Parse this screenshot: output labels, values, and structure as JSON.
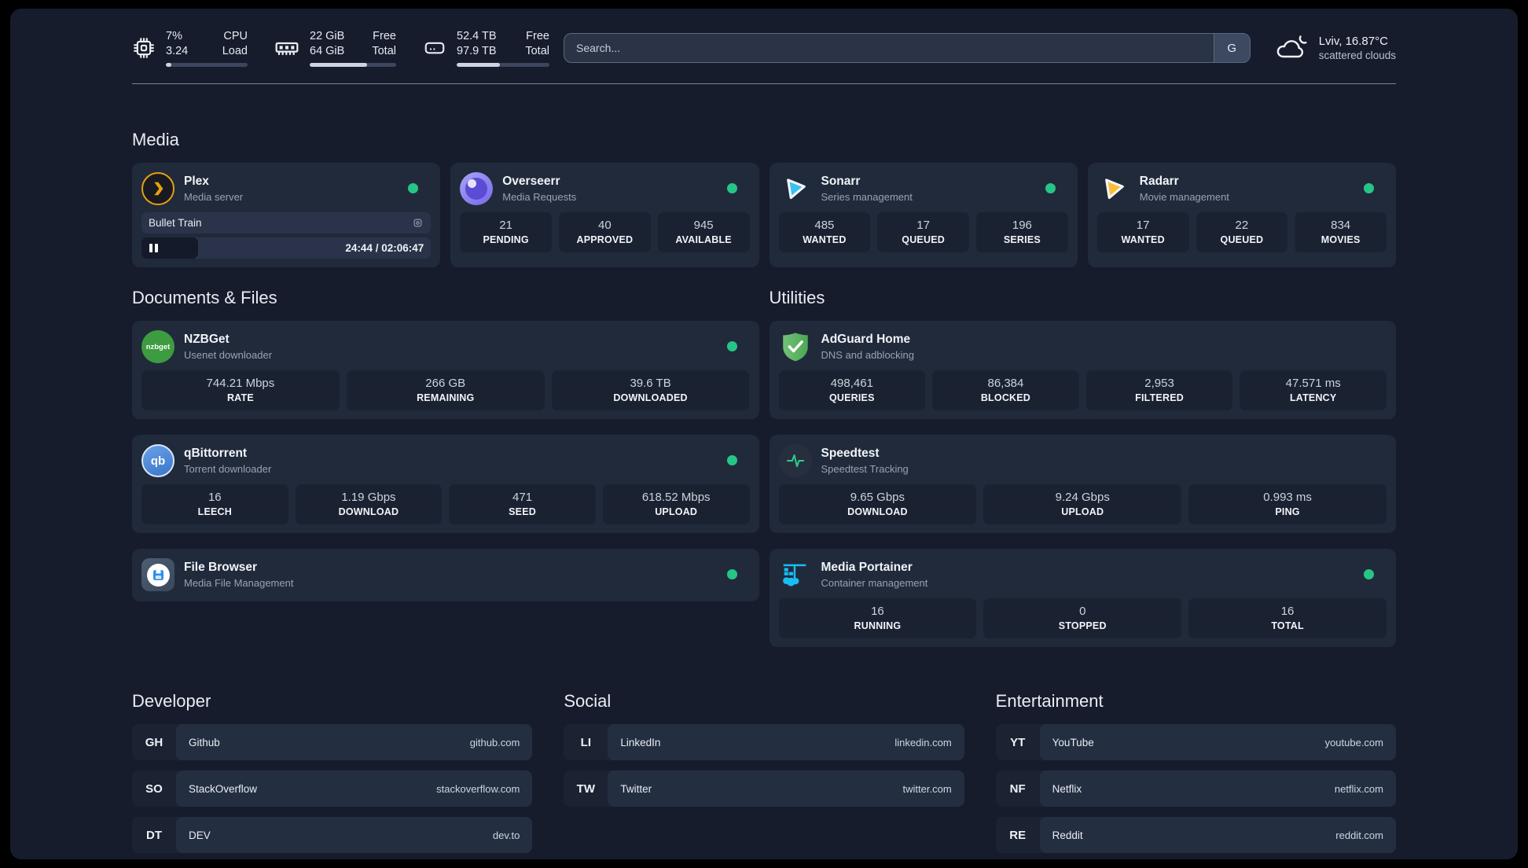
{
  "colors": {
    "page_background": "#161c2c",
    "card_background": "#212a3b",
    "status_online": "#26c585",
    "plex_gold": "#e5a00d",
    "overseerr_purple": "#7668ea",
    "sonarr_blue": "#39c1f0",
    "radarr_gold": "#fcbd35",
    "nzbget_green": "#3d9c40",
    "qbittorrent_blue": "#3a76ca",
    "filebrowser_blue": "#2f8fe8",
    "adguard_green": "#5fb562",
    "speedtest_green": "#2ecc8e",
    "portainer_blue": "#18bdf4"
  },
  "topbar": {
    "cpu": {
      "value1": "7%",
      "value2": "3.24",
      "label1": "CPU",
      "label2": "Load",
      "progress": 7
    },
    "ram": {
      "value1": "22 GiB",
      "value2": "64 GiB",
      "label1": "Free",
      "label2": "Total",
      "progress": 66
    },
    "disk": {
      "value1": "52.4 TB",
      "value2": "97.9 TB",
      "label1": "Free",
      "label2": "Total",
      "progress": 47
    },
    "search": {
      "placeholder": "Search...",
      "button_label": "G"
    },
    "weather": {
      "location": "Lviv, 16.87°C",
      "condition": "scattered clouds"
    }
  },
  "media": {
    "title": "Media",
    "plex": {
      "name": "Plex",
      "description": "Media server",
      "now_playing": "Bullet Train",
      "time": "24:44 / 02:06:47",
      "progress_percent": 19.5
    },
    "overseerr": {
      "name": "Overseerr",
      "description": "Media Requests",
      "stats": [
        {
          "value": "21",
          "label": "PENDING"
        },
        {
          "value": "40",
          "label": "APPROVED"
        },
        {
          "value": "945",
          "label": "AVAILABLE"
        }
      ]
    },
    "sonarr": {
      "name": "Sonarr",
      "description": "Series management",
      "stats": [
        {
          "value": "485",
          "label": "WANTED"
        },
        {
          "value": "17",
          "label": "QUEUED"
        },
        {
          "value": "196",
          "label": "SERIES"
        }
      ]
    },
    "radarr": {
      "name": "Radarr",
      "description": "Movie management",
      "stats": [
        {
          "value": "17",
          "label": "WANTED"
        },
        {
          "value": "22",
          "label": "QUEUED"
        },
        {
          "value": "834",
          "label": "MOVIES"
        }
      ]
    }
  },
  "documents": {
    "title": "Documents & Files",
    "nzbget": {
      "name": "NZBGet",
      "description": "Usenet downloader",
      "icon_text": "nzbget",
      "stats": [
        {
          "value": "744.21 Mbps",
          "label": "RATE"
        },
        {
          "value": "266 GB",
          "label": "REMAINING"
        },
        {
          "value": "39.6 TB",
          "label": "DOWNLOADED"
        }
      ]
    },
    "qbittorrent": {
      "name": "qBittorrent",
      "description": "Torrent downloader",
      "icon_text": "qb",
      "stats": [
        {
          "value": "16",
          "label": "LEECH"
        },
        {
          "value": "1.19 Gbps",
          "label": "DOWNLOAD"
        },
        {
          "value": "471",
          "label": "SEED"
        },
        {
          "value": "618.52 Mbps",
          "label": "UPLOAD"
        }
      ]
    },
    "filebrowser": {
      "name": "File Browser",
      "description": "Media File Management"
    }
  },
  "utilities": {
    "title": "Utilities",
    "adguard": {
      "name": "AdGuard Home",
      "description": "DNS and adblocking",
      "stats": [
        {
          "value": "498,461",
          "label": "QUERIES"
        },
        {
          "value": "86,384",
          "label": "BLOCKED"
        },
        {
          "value": "2,953",
          "label": "FILTERED"
        },
        {
          "value": "47.571 ms",
          "label": "LATENCY"
        }
      ]
    },
    "speedtest": {
      "name": "Speedtest",
      "description": "Speedtest Tracking",
      "stats": [
        {
          "value": "9.65 Gbps",
          "label": "DOWNLOAD"
        },
        {
          "value": "9.24 Gbps",
          "label": "UPLOAD"
        },
        {
          "value": "0.993 ms",
          "label": "PING"
        }
      ]
    },
    "portainer": {
      "name": "Media Portainer",
      "description": "Container management",
      "stats": [
        {
          "value": "16",
          "label": "RUNNING"
        },
        {
          "value": "0",
          "label": "STOPPED"
        },
        {
          "value": "16",
          "label": "TOTAL"
        }
      ]
    }
  },
  "bookmarks": {
    "developer": {
      "title": "Developer",
      "items": [
        {
          "abbr": "GH",
          "name": "Github",
          "url": "github.com"
        },
        {
          "abbr": "SO",
          "name": "StackOverflow",
          "url": "stackoverflow.com"
        },
        {
          "abbr": "DT",
          "name": "DEV",
          "url": "dev.to"
        }
      ]
    },
    "social": {
      "title": "Social",
      "items": [
        {
          "abbr": "LI",
          "name": "LinkedIn",
          "url": "linkedin.com"
        },
        {
          "abbr": "TW",
          "name": "Twitter",
          "url": "twitter.com"
        }
      ]
    },
    "entertainment": {
      "title": "Entertainment",
      "items": [
        {
          "abbr": "YT",
          "name": "YouTube",
          "url": "youtube.com"
        },
        {
          "abbr": "NF",
          "name": "Netflix",
          "url": "netflix.com"
        },
        {
          "abbr": "RE",
          "name": "Reddit",
          "url": "reddit.com"
        }
      ]
    }
  }
}
